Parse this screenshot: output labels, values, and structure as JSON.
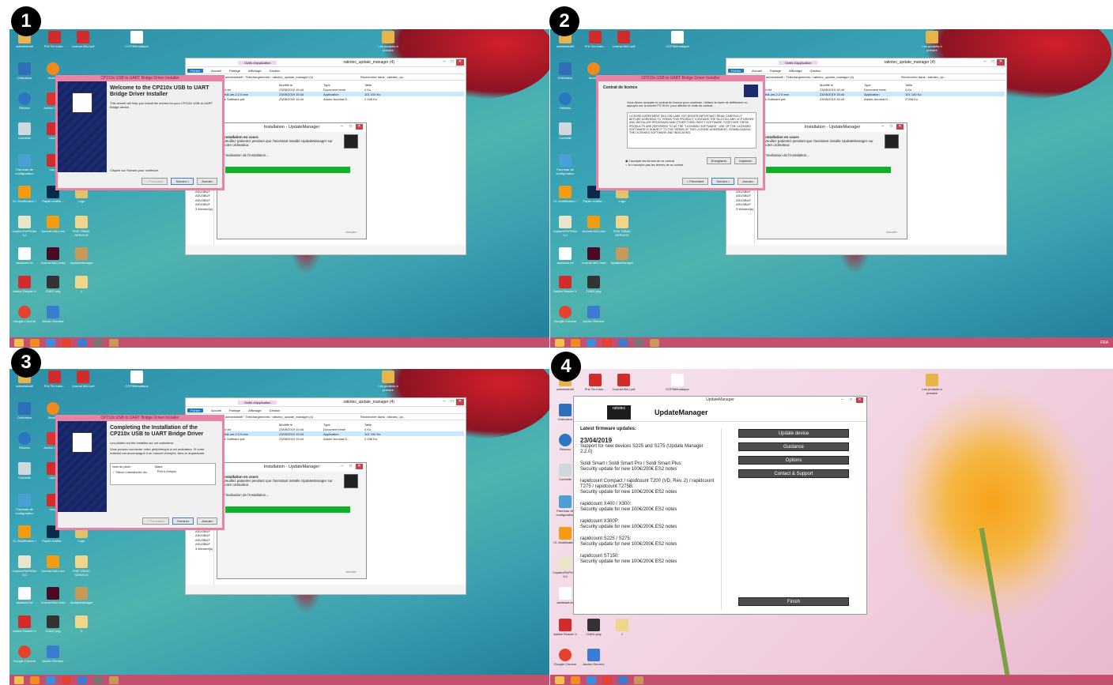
{
  "badges": [
    "1",
    "2",
    "3",
    "4"
  ],
  "colors": {
    "taskbar": "#c2506e",
    "installer_border": "#e982a5",
    "progress": "#0fb128",
    "um_button": "#4d4d4d"
  },
  "desktop_icons": [
    {
      "label": "administratif",
      "icon": "folder-icon"
    },
    {
      "label": "Prix Ter main...",
      "icon": "pdf-icon"
    },
    {
      "label": "Journal MAJ.pdf",
      "icon": "pdf-icon"
    },
    {
      "label": "CCP/Mématique",
      "icon": "file-icon"
    },
    {
      "label": "Les produits à prendre",
      "icon": "folder-icon"
    },
    {
      "label": "Ordinateur",
      "icon": "computer-icon"
    },
    {
      "label": "Mozilla",
      "icon": "firefox-icon"
    },
    {
      "label": "Réseau",
      "icon": "network-icon"
    },
    {
      "label": "Adobe Cloud",
      "icon": "adobe-icon"
    },
    {
      "label": "Corbeille",
      "icon": "trash-icon"
    },
    {
      "label": "LAUR",
      "icon": "pdf-icon"
    },
    {
      "label": "Panneau de configuration",
      "icon": "control-panel-icon"
    },
    {
      "label": "ma-p",
      "icon": "pdf-icon"
    },
    {
      "label": "CL Modification !",
      "icon": "file-icon"
    },
    {
      "label": "Papier entête...",
      "icon": "ps-icon"
    },
    {
      "label": "Logo",
      "icon": "image-icon"
    },
    {
      "label": "CaptureFlePrtScr 3.0",
      "icon": "capture-icon"
    },
    {
      "label": "Journal MAJ.doc",
      "icon": "doc-icon"
    },
    {
      "label": "PUB TABAC SERVICE",
      "icon": "doc-icon"
    },
    {
      "label": "assistant.txt",
      "icon": "txt-icon"
    },
    {
      "label": "Journal MAJ.indd",
      "icon": "indesign-icon"
    },
    {
      "label": "UpdateManager",
      "icon": "updatemanager-icon"
    },
    {
      "label": "Adobe Reader X",
      "icon": "acrobat-icon"
    },
    {
      "label": "21802.png",
      "icon": "png-icon"
    },
    {
      "label": "1",
      "icon": "folder-icon"
    },
    {
      "label": "Google Chrome",
      "icon": "chrome-icon"
    },
    {
      "label": "Ancien Serveur",
      "icon": "shortcut-icon"
    }
  ],
  "explorer": {
    "title": "ratiotec_update_manager (4)",
    "context_tab": "Outils d'application",
    "ribbon": [
      "Fichier",
      "Accueil",
      "Partage",
      "Affichage",
      "Gestion"
    ],
    "path": "administratif › Téléchargements › ratiotec_update_manager (4)",
    "search": "Rechercher dans : ratiotec_up...",
    "columns": [
      "Nom",
      "Modifié le",
      "Type",
      "Taille"
    ],
    "files": [
      {
        "name": "readme.txt",
        "date": "23/05/2019 15:44",
        "type": "Document texte",
        "size": "4 Ko"
      },
      {
        "name": "setup-full-um-2.2.0.exe",
        "date": "23/05/2019 15:44",
        "type": "Application",
        "size": "101 100 Ko"
      },
      {
        "name": "Update Software.pdf",
        "date": "23/05/2019 15:44",
        "type": "Adobe Acrobat D...",
        "size": "2 038 Ko"
      }
    ],
    "nav": [
      "Files",
      "récents",
      "rts"
    ],
    "side_items": [
      "ASUSBUF",
      "ASUSBUF",
      "ASUSBUF",
      "ASUSBUF",
      "ASUSBUF"
    ],
    "status": "3 élément(s)"
  },
  "update_install": {
    "title": "Installation - UpdateManager",
    "heading": "Installation en cours",
    "desc": "Veuillez patienter pendant que l'assistant installe UpdateManager sur votre ordinateur.",
    "status": "Finalisation de l'installation...",
    "cancel": "Annuler",
    "progress": 0.9
  },
  "installer1": {
    "title": "CP210x USB to UART Bridge Driver Installer",
    "heading": "Welcome to the CP210x USB to UART Bridge Driver Installer",
    "desc": "This wizard will help you install the drivers for your CP210x USB to UART Bridge device.",
    "hint": "Cliquez sur Suivant pour continuer.",
    "buttons": [
      "< Précédent",
      "Suivant >",
      "Annuler"
    ]
  },
  "installer2": {
    "title": "CP210x USB to UART Bridge Driver Installer",
    "heading": "Contrat de licence",
    "desc": "Vous devez accepter le contrat de licence pour continuer. Utilisez la barre de défilement ou appuyez sur la touche PG SUIV. pour afficher le reste du contrat.",
    "license": "LICENSE AGREEMENT\nSILICON LABS VCP DRIVER\nIMPORTANT: READ CAREFULLY BEFORE AGREEING TO TERMS\n\nTHIS PRODUCT CONTAINS THE SILICON LABS VCP DRIVER AND INSTALLER PROGRAMS AND OTHER THIRD PARTY SOFTWARE.TOGETHER THESE PRODUCTS ARE REFERRED TO AS THE \"LICENSED SOFTWARE\". USE OF THE LICENSED SOFTWARE IS SUBJECT TO THE TERMS OF THIS LICENSE AGREEMENT. DOWNLOADING THE LICENSED SOFTWARE AND INDICATING",
    "radio_accept": "J'accepte les termes de ce contrat",
    "radio_decline": "Je n'accepte pas les termes de ce contrat",
    "save": "Enregistrer",
    "print": "Imprimer",
    "buttons": [
      "< Précédent",
      "Suivant >",
      "Annuler"
    ]
  },
  "installer3": {
    "title": "CP210x USB to UART Bridge Driver Installer",
    "heading": "Completing the Installation of the CP210x USB to UART Bridge Driver",
    "desc1": "Les pilotes ont été installés sur cet ordinateur.",
    "desc2": "Vous pouvez connecter votre périphérique à cet ordinateur. Si votre matériel est accompagné d'un manuel d'emploi, lisez-le auparavant.",
    "col_name": "Nom du pilote",
    "col_status": "Statut",
    "driver_name": "✓ Silicon Laboratories Inc...",
    "driver_status": "Prêt à l'emploi",
    "buttons": [
      "< Précédent",
      "Terminer",
      "Annuler"
    ]
  },
  "updatemanager": {
    "window_title": "UpdateManager",
    "brand": "ratiotec",
    "app_name": "UpdateManager",
    "latest_title": "Latest firmware updates:",
    "date": "23/04/2019",
    "date_text": "Support for new devices S225 and S275 (Update Manager 2.2.0)",
    "updates": [
      {
        "model": "Soldi Smart / Soldi Smart Pro / Soldi Smart Plus:",
        "note": "Security update for new 100€/200€ ES2 notes"
      },
      {
        "model": "rapidcount Compact / rapidcount T200 (VD, Rev. 2) / rapidcount T275 / rapidcount T275B:",
        "note": "Security update for new 100€/200€ ES2 notes"
      },
      {
        "model": "rapidcount X400 / X300:",
        "note": "Security update for new 100€/200€ ES2 notes"
      },
      {
        "model": "rapidcount X300P:",
        "note": "Security update for new 100€/200€ ES2 notes"
      },
      {
        "model": "rapidcount S225 / S275:",
        "note": "Security update for new 100€/200€ ES2 notes"
      },
      {
        "model": "rapidcount ST150:",
        "note": "Security update for new 100€/200€ ES2 notes"
      }
    ],
    "buttons": [
      "Update device",
      "Guidance",
      "Options",
      "Contact & Support"
    ],
    "finish": "Finish"
  },
  "tray": "FRA"
}
